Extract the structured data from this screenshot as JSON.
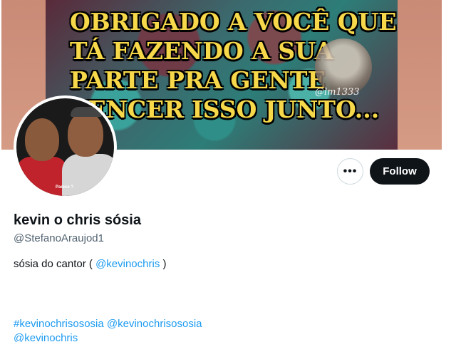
{
  "banner": {
    "lines": [
      "OBRIGADO A VOCÊ QUE",
      "TÁ FAZENDO A SUA",
      "PARTE PRA GENTE",
      "VENCER ISSO JUNTO..."
    ],
    "signature": "@lm1333"
  },
  "avatar": {
    "caption": "Parece ?"
  },
  "actions": {
    "more_label": "•••",
    "follow_label": "Follow"
  },
  "profile": {
    "display_name": "kevin o chris sósia",
    "handle": "@StefanoAraujod1",
    "bio_prefix": "sósia do cantor ( ",
    "bio_mention": "@kevinochris",
    "bio_suffix": " )",
    "hashtag_1": "#kevinochrisososia",
    "hashtag_2": "@kevinochrisososia",
    "mention_2": "@kevinochris"
  },
  "colors": {
    "accent": "#1d9bf0",
    "follow_bg": "#0f1419",
    "banner_bg": "#c98a76",
    "banner_text": "#f6d84a"
  }
}
